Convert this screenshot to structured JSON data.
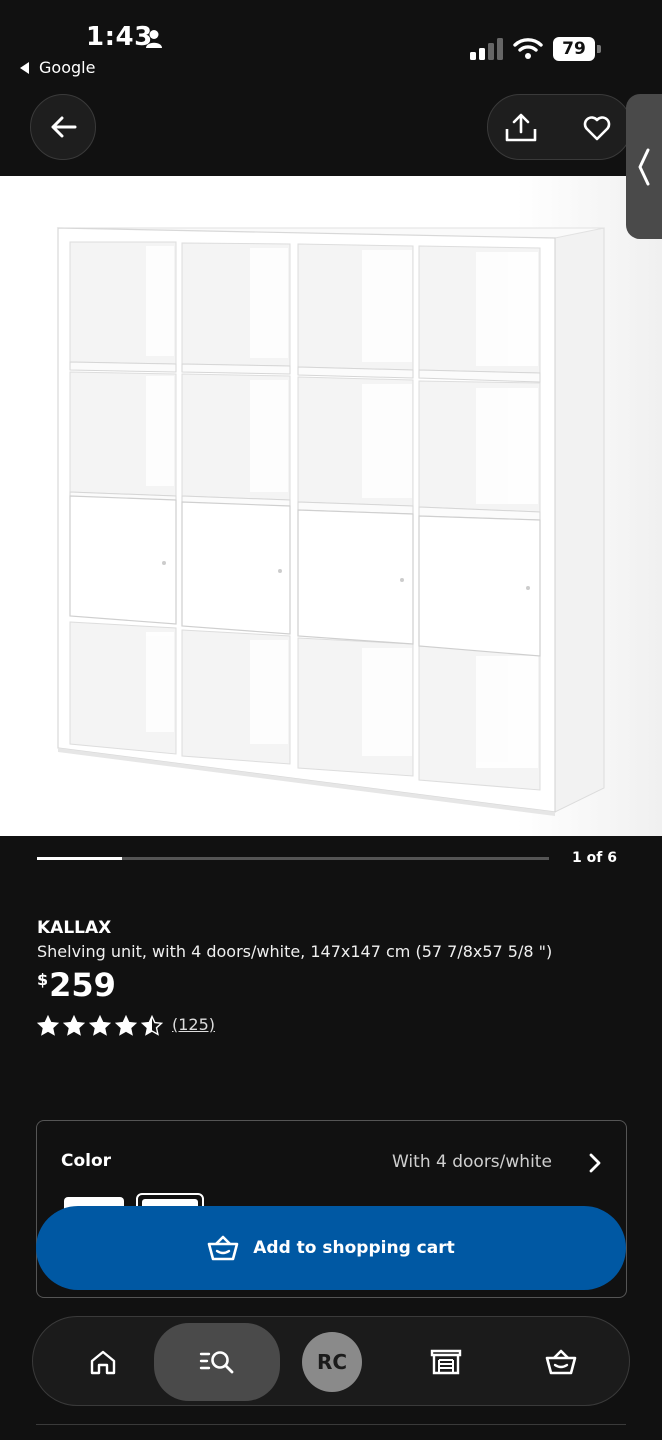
{
  "status_bar": {
    "time": "1:43",
    "back_app": "Google",
    "battery": "79"
  },
  "gallery": {
    "counter": "1 of 6",
    "progress": 0.166
  },
  "product": {
    "name": "KALLAX",
    "description": "Shelving unit, with 4 doors/white, 147x147 cm (57 7/8x57 5/8 \")",
    "price_currency": "$",
    "price_amount": "259",
    "rating": 4.5,
    "review_count": "(125)"
  },
  "variant": {
    "color_label": "Color",
    "color_value": "With 4 doors/white"
  },
  "actions": {
    "add_to_cart_label": "Add to shopping cart"
  },
  "nav": {
    "profile_initials": "RC",
    "items": [
      "home-icon",
      "search-icon",
      "avatar",
      "store-icon",
      "cart-icon"
    ]
  },
  "colors": {
    "background": "#111111",
    "accent_blue": "#0058a3",
    "product_bg": "#ffffff"
  }
}
